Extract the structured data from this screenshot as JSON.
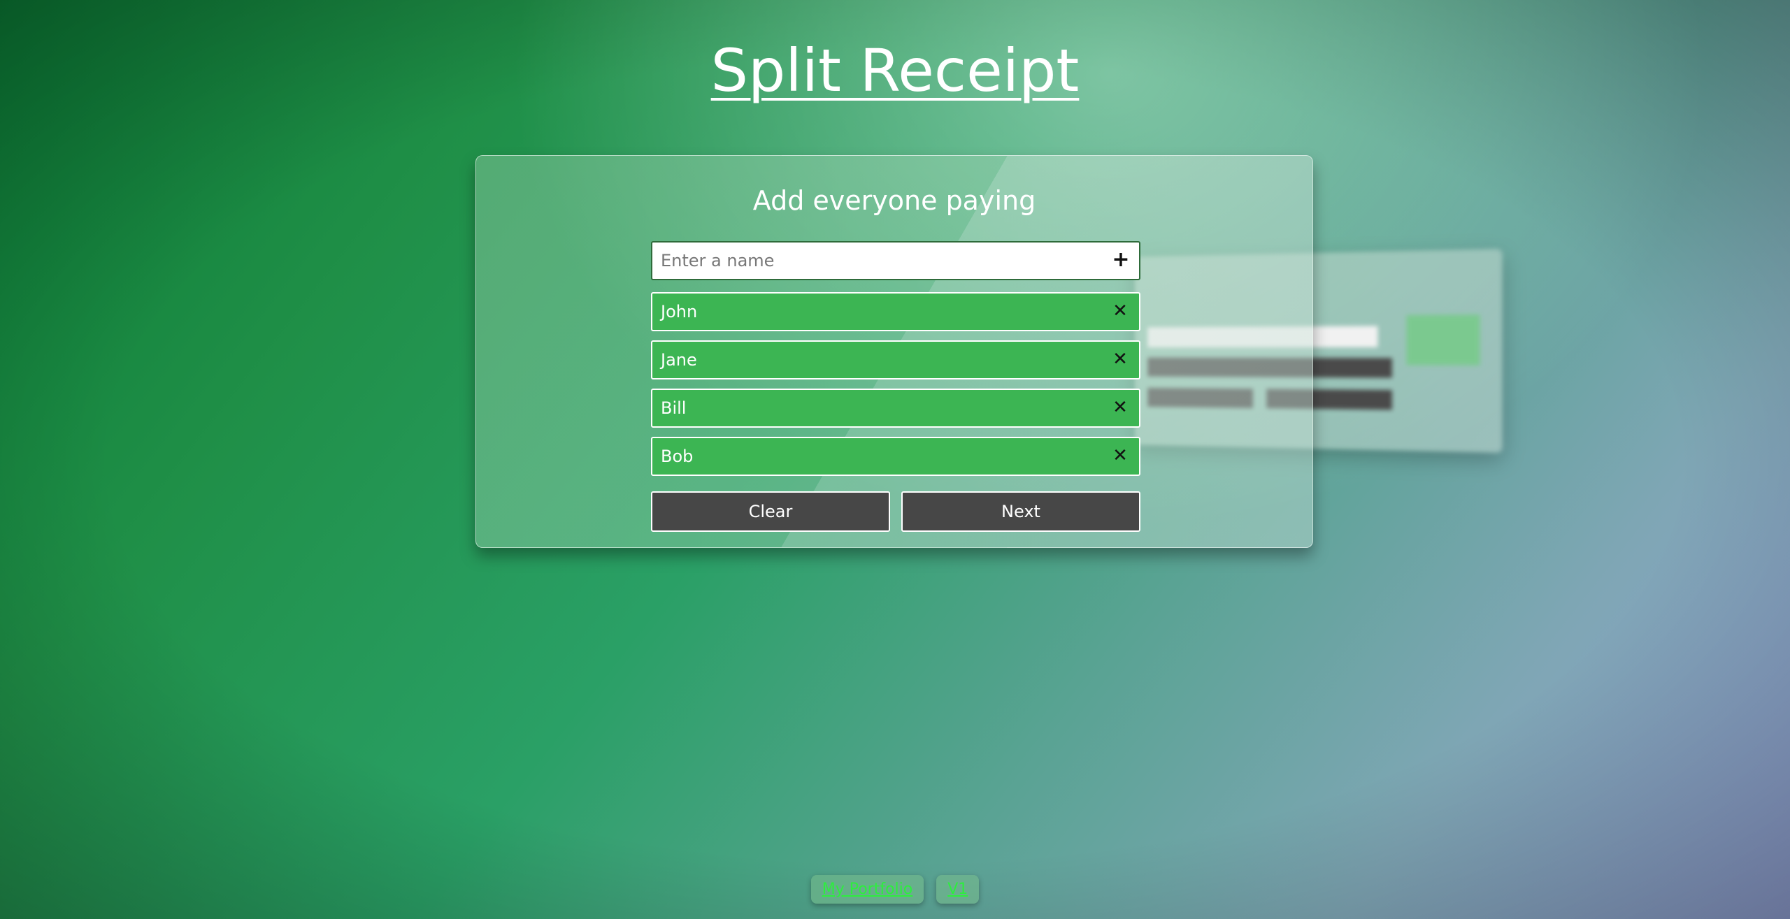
{
  "page": {
    "title": "Split Receipt"
  },
  "card": {
    "heading": "Add everyone paying",
    "name_input": {
      "placeholder": "Enter a name",
      "value": ""
    },
    "add_icon": "+",
    "remove_icon": "✕",
    "people": [
      {
        "name": "John"
      },
      {
        "name": "Jane"
      },
      {
        "name": "Bill"
      },
      {
        "name": "Bob"
      }
    ],
    "buttons": {
      "clear_label": "Clear",
      "next_label": "Next"
    }
  },
  "footer": {
    "portfolio_label": "My Portfolio",
    "version_label": "V1"
  },
  "colors": {
    "person_bg": "#3cb553",
    "button_bg": "#474747",
    "footer_link": "#2dee3e"
  }
}
